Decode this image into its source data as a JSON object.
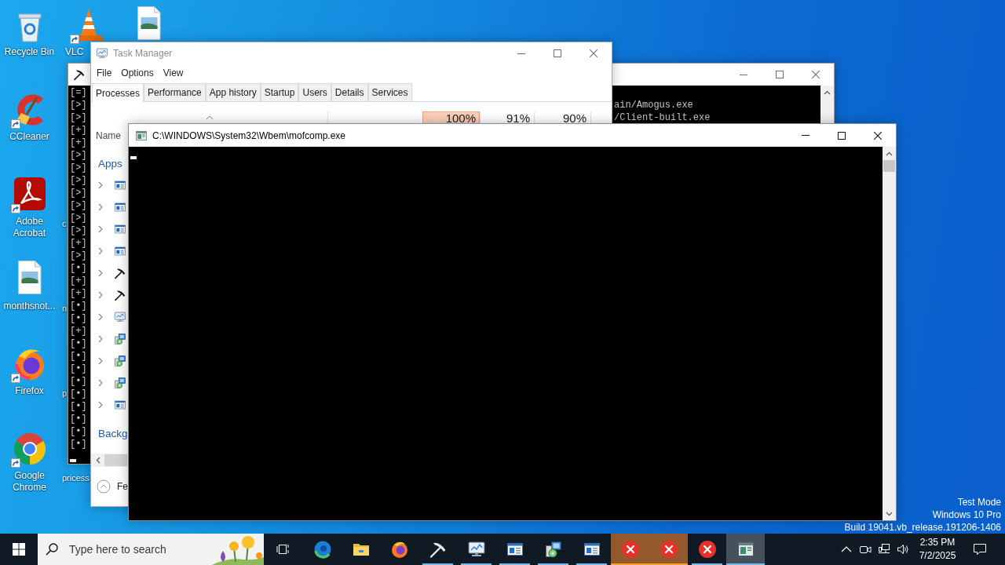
{
  "desktop": {
    "icons": [
      {
        "label": "Recycle Bin",
        "kind": "recycle",
        "shortcut": false
      },
      {
        "label": "CCleaner",
        "kind": "cleaner",
        "shortcut": true
      },
      {
        "label": "Adobe Acrobat",
        "kind": "pdf",
        "shortcut": true
      },
      {
        "label": "monthsnot...",
        "kind": "image",
        "shortcut": false
      },
      {
        "label": "Firefox",
        "kind": "fox",
        "shortcut": true
      },
      {
        "label": "Google Chrome",
        "kind": "chrome",
        "shortcut": true
      }
    ],
    "top_row": [
      {
        "label": "VLC",
        "kind": "cone",
        "shortcut": true
      },
      {
        "kind": "image",
        "shortcut": false
      }
    ],
    "covered_labels": [
      "c",
      "n",
      "p",
      "pricess"
    ],
    "system_notice": [
      "Test Mode",
      "Windows 10 Pro",
      "Build 19041.vb_release.191206-1406"
    ]
  },
  "console": {
    "active": false,
    "lines": [
      {
        "prefix": "[=]"
      },
      {
        "prefix": "[>]",
        "tail": "ain/Amogus.exe"
      },
      {
        "prefix": "[>]",
        "tail": "/Client-built.exe"
      },
      {
        "prefix": "[+]"
      },
      {
        "prefix": "[+]"
      },
      {
        "prefix": "[>]"
      },
      {
        "prefix": "[>]"
      },
      {
        "prefix": "[>]"
      },
      {
        "prefix": "[>]"
      },
      {
        "prefix": "[>]"
      },
      {
        "prefix": "[>]"
      },
      {
        "prefix": "[>]"
      },
      {
        "prefix": "[+]"
      },
      {
        "prefix": "[>]"
      },
      {
        "prefix": "[•]"
      },
      {
        "prefix": "[+]"
      },
      {
        "prefix": "[+]"
      },
      {
        "prefix": "[•]"
      },
      {
        "prefix": "[•]"
      },
      {
        "prefix": "[+]"
      },
      {
        "prefix": "[•]"
      },
      {
        "prefix": "[•]"
      },
      {
        "prefix": "[•]"
      },
      {
        "prefix": "[•]"
      },
      {
        "prefix": "[•]"
      },
      {
        "prefix": "[•]"
      },
      {
        "prefix": "[•]"
      },
      {
        "prefix": "[•]"
      },
      {
        "prefix": "[•]"
      }
    ]
  },
  "task_manager": {
    "title": "Task Manager",
    "active": false,
    "menu": [
      "File",
      "Options",
      "View"
    ],
    "tabs": [
      {
        "label": "Processes",
        "selected": true
      },
      {
        "label": "Performance",
        "selected": false
      },
      {
        "label": "App history",
        "selected": false
      },
      {
        "label": "Startup",
        "selected": false
      },
      {
        "label": "Users",
        "selected": false
      },
      {
        "label": "Details",
        "selected": false
      },
      {
        "label": "Services",
        "selected": false
      }
    ],
    "name_column": "Name",
    "usage": [
      {
        "value": "100%",
        "highlight": true
      },
      {
        "value": "91%",
        "highlight": false
      },
      {
        "value": "90%",
        "highlight": false
      }
    ],
    "groups": [
      {
        "heading": "Apps",
        "rows": [
          {
            "kind": "window",
            "expanded": false
          },
          {
            "kind": "window",
            "expanded": false
          },
          {
            "kind": "window",
            "expanded": false
          },
          {
            "kind": "window",
            "expanded": false
          },
          {
            "kind": "hammer",
            "expanded": false
          },
          {
            "kind": "hammer",
            "expanded": false
          },
          {
            "kind": "monitor",
            "expanded": false
          },
          {
            "kind": "installer",
            "expanded": false
          },
          {
            "kind": "installer",
            "expanded": false
          },
          {
            "kind": "installer",
            "expanded": false
          },
          {
            "kind": "window",
            "expanded": false
          }
        ]
      },
      {
        "heading": "Backg"
      }
    ],
    "footer": "Fe"
  },
  "command_window": {
    "title": "C:\\WINDOWS\\System32\\Wbem\\mofcomp.exe",
    "active": true
  },
  "taskbar": {
    "search": {
      "placeholder": "Type here to search"
    },
    "apps": [
      {
        "kind": "swirl",
        "running": false,
        "attention": false,
        "active": false
      },
      {
        "kind": "folder",
        "running": false,
        "attention": false,
        "active": false
      },
      {
        "kind": "fox",
        "running": false,
        "attention": false,
        "active": false
      },
      {
        "kind": "hammer",
        "running": true,
        "attention": false,
        "active": false
      },
      {
        "kind": "monitor",
        "running": true,
        "attention": false,
        "active": false
      },
      {
        "kind": "window",
        "running": true,
        "attention": false,
        "active": false
      },
      {
        "kind": "installer",
        "running": true,
        "attention": false,
        "active": false
      },
      {
        "kind": "window",
        "running": true,
        "attention": false,
        "active": false
      },
      {
        "kind": "error",
        "running": true,
        "attention": true,
        "active": false
      },
      {
        "kind": "error",
        "running": true,
        "attention": true,
        "active": false
      },
      {
        "kind": "error",
        "running": true,
        "attention": false,
        "active": false
      },
      {
        "kind": "console",
        "running": true,
        "attention": false,
        "active": true
      }
    ],
    "clock": {
      "time": "2:35 PM",
      "date": "7/2/2025"
    }
  }
}
